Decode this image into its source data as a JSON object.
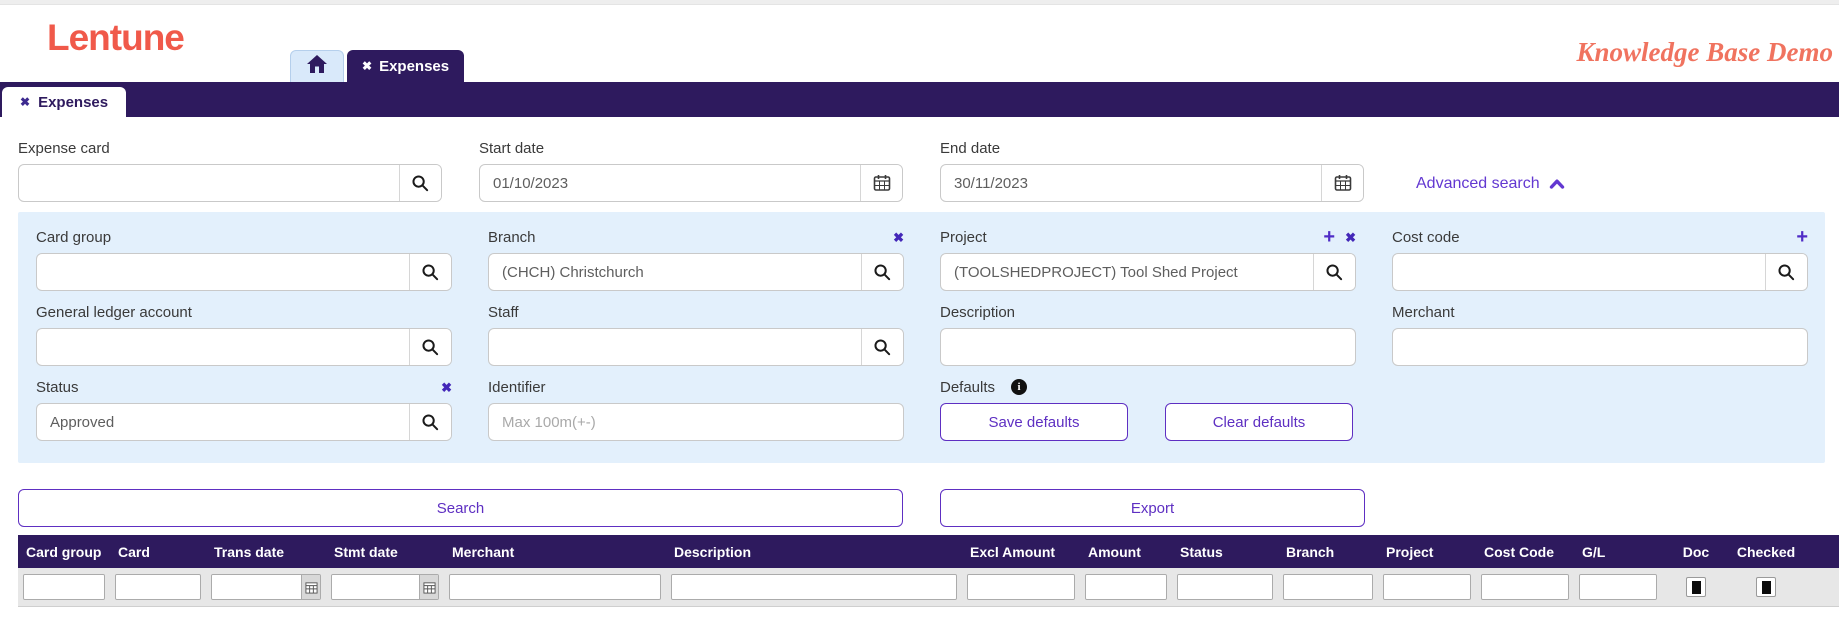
{
  "app": {
    "logo_text": "Lentune",
    "tagline": "Knowledge Base Demo"
  },
  "icons": {
    "close": "✖",
    "plus": "+",
    "info": "i"
  },
  "tabs": {
    "expenses_tab_label": "Expenses",
    "page_tab_label": "Expenses"
  },
  "filters": {
    "expense_card": {
      "label": "Expense card",
      "value": ""
    },
    "start_date": {
      "label": "Start date",
      "value": "01/10/2023"
    },
    "end_date": {
      "label": "End date",
      "value": "30/11/2023"
    },
    "advanced_search_label": "Advanced search",
    "card_group": {
      "label": "Card group",
      "value": ""
    },
    "branch": {
      "label": "Branch",
      "value": "(CHCH) Christchurch"
    },
    "project": {
      "label": "Project",
      "value": "(TOOLSHEDPROJECT) Tool Shed Project"
    },
    "cost_code": {
      "label": "Cost code",
      "value": ""
    },
    "general_ledger_account": {
      "label": "General ledger account",
      "value": ""
    },
    "staff": {
      "label": "Staff",
      "value": ""
    },
    "description": {
      "label": "Description",
      "value": ""
    },
    "merchant": {
      "label": "Merchant",
      "value": ""
    },
    "status": {
      "label": "Status",
      "value": "Approved"
    },
    "identifier": {
      "label": "Identifier",
      "placeholder": "Max 100m(+-)"
    },
    "defaults": {
      "label": "Defaults",
      "save_label": "Save defaults",
      "clear_label": "Clear defaults"
    }
  },
  "actions": {
    "search_label": "Search",
    "export_label": "Export"
  },
  "table": {
    "columns": [
      {
        "key": "card-group",
        "label": "Card group",
        "filter": "text"
      },
      {
        "key": "card",
        "label": "Card",
        "filter": "text"
      },
      {
        "key": "trans-date",
        "label": "Trans date",
        "filter": "date"
      },
      {
        "key": "stmt-date",
        "label": "Stmt date",
        "filter": "date"
      },
      {
        "key": "merchant",
        "label": "Merchant",
        "filter": "text"
      },
      {
        "key": "description",
        "label": "Description",
        "filter": "text"
      },
      {
        "key": "excl-amount",
        "label": "Excl Amount",
        "filter": "text"
      },
      {
        "key": "amount",
        "label": "Amount",
        "filter": "text"
      },
      {
        "key": "status",
        "label": "Status",
        "filter": "text"
      },
      {
        "key": "branch",
        "label": "Branch",
        "filter": "text"
      },
      {
        "key": "project",
        "label": "Project",
        "filter": "text"
      },
      {
        "key": "cost-code",
        "label": "Cost Code",
        "filter": "text"
      },
      {
        "key": "gl",
        "label": "G/L",
        "filter": "text"
      },
      {
        "key": "doc",
        "label": "Doc",
        "filter": "check"
      },
      {
        "key": "checked",
        "label": "Checked",
        "filter": "check"
      }
    ],
    "rows": []
  },
  "colors": {
    "brand": "#F0594A",
    "header_purple": "#2E1A5E",
    "accent_purple": "#5E2FC2",
    "panel_blue": "#E3F0FC"
  }
}
